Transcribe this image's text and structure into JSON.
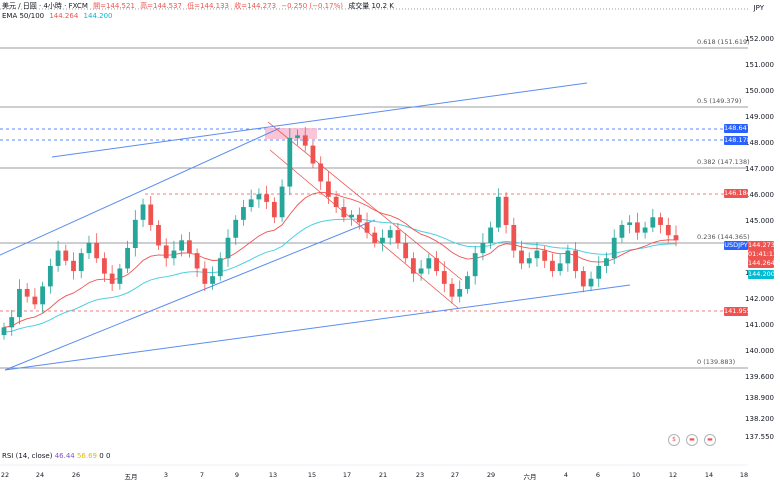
{
  "header": {
    "symbol": "美元 / 日圓 · 4小時 · FXCM",
    "open": "開=144.521",
    "high": "高=144.537",
    "low": "低=144.133",
    "close": "收=144.273",
    "change": "−0.250 (−0.17%)",
    "volume": "成交量 10.2 K",
    "ema_label": "EMA 50/100",
    "ema50": "144.264",
    "ema100": "144.200"
  },
  "currency": "JPY",
  "price_axis": {
    "ticks": [
      "152.000",
      "151.000",
      "150.000",
      "149.000",
      "148.000",
      "147.000",
      "146.000",
      "145.000",
      "144.000",
      "143.000",
      "142.000",
      "141.000",
      "140.000",
      "139.600",
      "138.900",
      "138.200",
      "137.550"
    ]
  },
  "fib_levels": [
    {
      "label": "0.618 (151.619)",
      "price": 151.619
    },
    {
      "label": "0.5 (149.379)",
      "price": 149.379
    },
    {
      "label": "0.382 (147.138)",
      "price": 147.138
    },
    {
      "label": "0.236 (144.365)",
      "price": 144.365
    },
    {
      "label": "0 (139.883)",
      "price": 139.883
    }
  ],
  "price_tags": {
    "t1": "148.647",
    "t2": "148.178",
    "t3": "146.184",
    "symbol": "USDJPY",
    "last": "144.273",
    "countdown": "01:41:13",
    "ema50": "144.264",
    "ema100": "144.200",
    "t4": "141.955"
  },
  "x_axis": {
    "labels": [
      "22",
      "24",
      "26",
      "五月",
      "3",
      "7",
      "9",
      "13",
      "15",
      "17",
      "21",
      "23",
      "27",
      "29",
      "六月",
      "4",
      "6",
      "10",
      "12",
      "14",
      "18"
    ]
  },
  "rsi": {
    "label": "RSI (14, close)",
    "v1": "46.44",
    "v2": "56.69",
    "v3": "0",
    "v4": "0"
  },
  "colors": {
    "bull": "#26a69a",
    "bear": "#ef5350",
    "ema50": "#ef5350",
    "ema100": "#4dd0e1",
    "trend": "#5b8def"
  },
  "chart_data": {
    "type": "candlestick",
    "ylim": [
      137.55,
      152.5
    ],
    "closes": [
      140.9,
      141.3,
      142.4,
      142.1,
      141.8,
      142.5,
      143.3,
      143.9,
      143.5,
      143.1,
      143.8,
      144.2,
      143.6,
      143.0,
      142.6,
      143.2,
      144.0,
      145.1,
      145.7,
      144.9,
      144.1,
      143.6,
      143.9,
      144.3,
      143.8,
      143.2,
      142.6,
      142.9,
      143.6,
      144.4,
      145.1,
      145.6,
      145.9,
      146.1,
      145.8,
      145.2,
      146.4,
      148.3,
      148.4,
      148.0,
      147.3,
      146.6,
      146.0,
      145.6,
      145.2,
      145.3,
      145.0,
      144.6,
      144.2,
      144.4,
      144.7,
      144.2,
      143.6,
      143.0,
      143.2,
      143.6,
      143.1,
      142.6,
      142.1,
      142.4,
      142.9,
      143.8,
      144.2,
      144.8,
      146.0,
      144.9,
      143.9,
      143.4,
      143.6,
      143.9,
      143.5,
      143.1,
      143.4,
      143.9,
      143.1,
      142.5,
      142.8,
      143.3,
      143.6,
      144.4,
      144.9,
      145.0,
      144.6,
      144.8,
      145.2,
      144.9,
      144.5,
      144.3
    ]
  }
}
